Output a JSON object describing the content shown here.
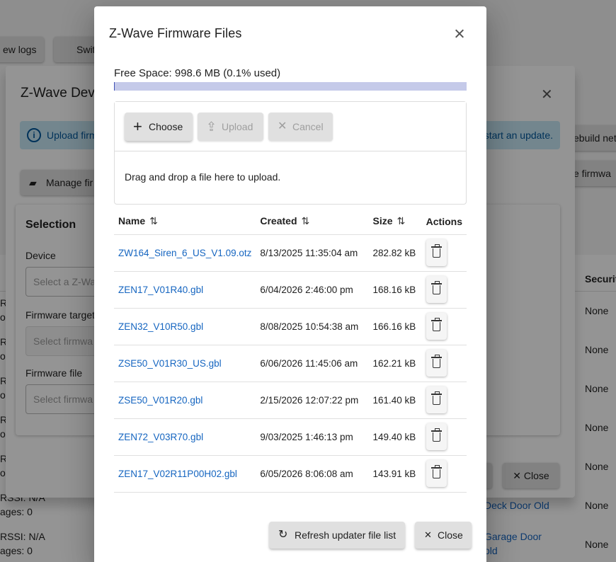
{
  "background": {
    "view_logs_label": "ew logs",
    "switch_label": "Swit",
    "rebuild_label": "ebuild net",
    "firmware_label": "e firmwa",
    "security_header": "Securit",
    "rows": [
      {
        "left1": "R",
        "left2": "og",
        "security": "None"
      },
      {
        "left1": "R",
        "left2": "og",
        "security": "None"
      },
      {
        "left1": "R",
        "left2": "og",
        "security": "None"
      },
      {
        "left1": "R",
        "left2": "og",
        "security": "None"
      },
      {
        "left1": "R",
        "left2": "og",
        "security": "None"
      },
      {
        "left1": "RSSI: N/A",
        "left2": "ages: 0",
        "link": "Deck Door Old",
        "security": "None"
      },
      {
        "left1": "RSSI: N/A",
        "left2": "ages: 0",
        "link": "Garage Door",
        "link2": "old",
        "security": "None"
      }
    ]
  },
  "device_dialog": {
    "title": "Z-Wave Devic",
    "alert_left": "Upload firm",
    "alert_right": "start an update.",
    "manage_button": "Manage fir",
    "selection_title": "Selection",
    "device_label": "Device",
    "device_placeholder": "Select a Z-Wa",
    "target_label": "Firmware target",
    "target_placeholder": "Select firmwa",
    "file_label": "Firmware file",
    "file_placeholder": "Select firmwa",
    "close_button": "Close"
  },
  "dialog": {
    "title": "Z-Wave Firmware Files",
    "free_space": "Free Space: 998.6 MB (0.1% used)",
    "used_fraction": 0.001,
    "choose_label": "Choose",
    "upload_label": "Upload",
    "cancel_label": "Cancel",
    "drop_text": "Drag and drop a file here to upload.",
    "columns": {
      "name": "Name",
      "created": "Created",
      "size": "Size",
      "actions": "Actions"
    },
    "files": [
      {
        "name": "ZW164_Siren_6_US_V1.09.otz",
        "created": "8/13/2025 11:35:04 am",
        "size": "282.82 kB"
      },
      {
        "name": "ZEN17_V01R40.gbl",
        "created": "6/04/2026 2:46:00 pm",
        "size": "168.16 kB"
      },
      {
        "name": "ZEN32_V10R50.gbl",
        "created": "8/08/2025 10:54:38 am",
        "size": "166.16 kB"
      },
      {
        "name": "ZSE50_V01R30_US.gbl",
        "created": "6/06/2026 11:45:06 am",
        "size": "162.21 kB"
      },
      {
        "name": "ZSE50_V01R20.gbl",
        "created": "2/15/2026 12:07:22 pm",
        "size": "161.40 kB"
      },
      {
        "name": "ZEN72_V03R70.gbl",
        "created": "9/03/2025 1:46:13 pm",
        "size": "149.40 kB"
      },
      {
        "name": "ZEN17_V02R11P00H02.gbl",
        "created": "6/05/2026 8:06:08 am",
        "size": "143.91 kB"
      }
    ],
    "refresh_button": "Refresh updater file list",
    "close_button": "Close"
  },
  "colors": {
    "link": "#1565c0",
    "progress_track": "#c5cae9",
    "progress_fill": "#3f51b5",
    "alert_bg": "#c6e7f4"
  }
}
